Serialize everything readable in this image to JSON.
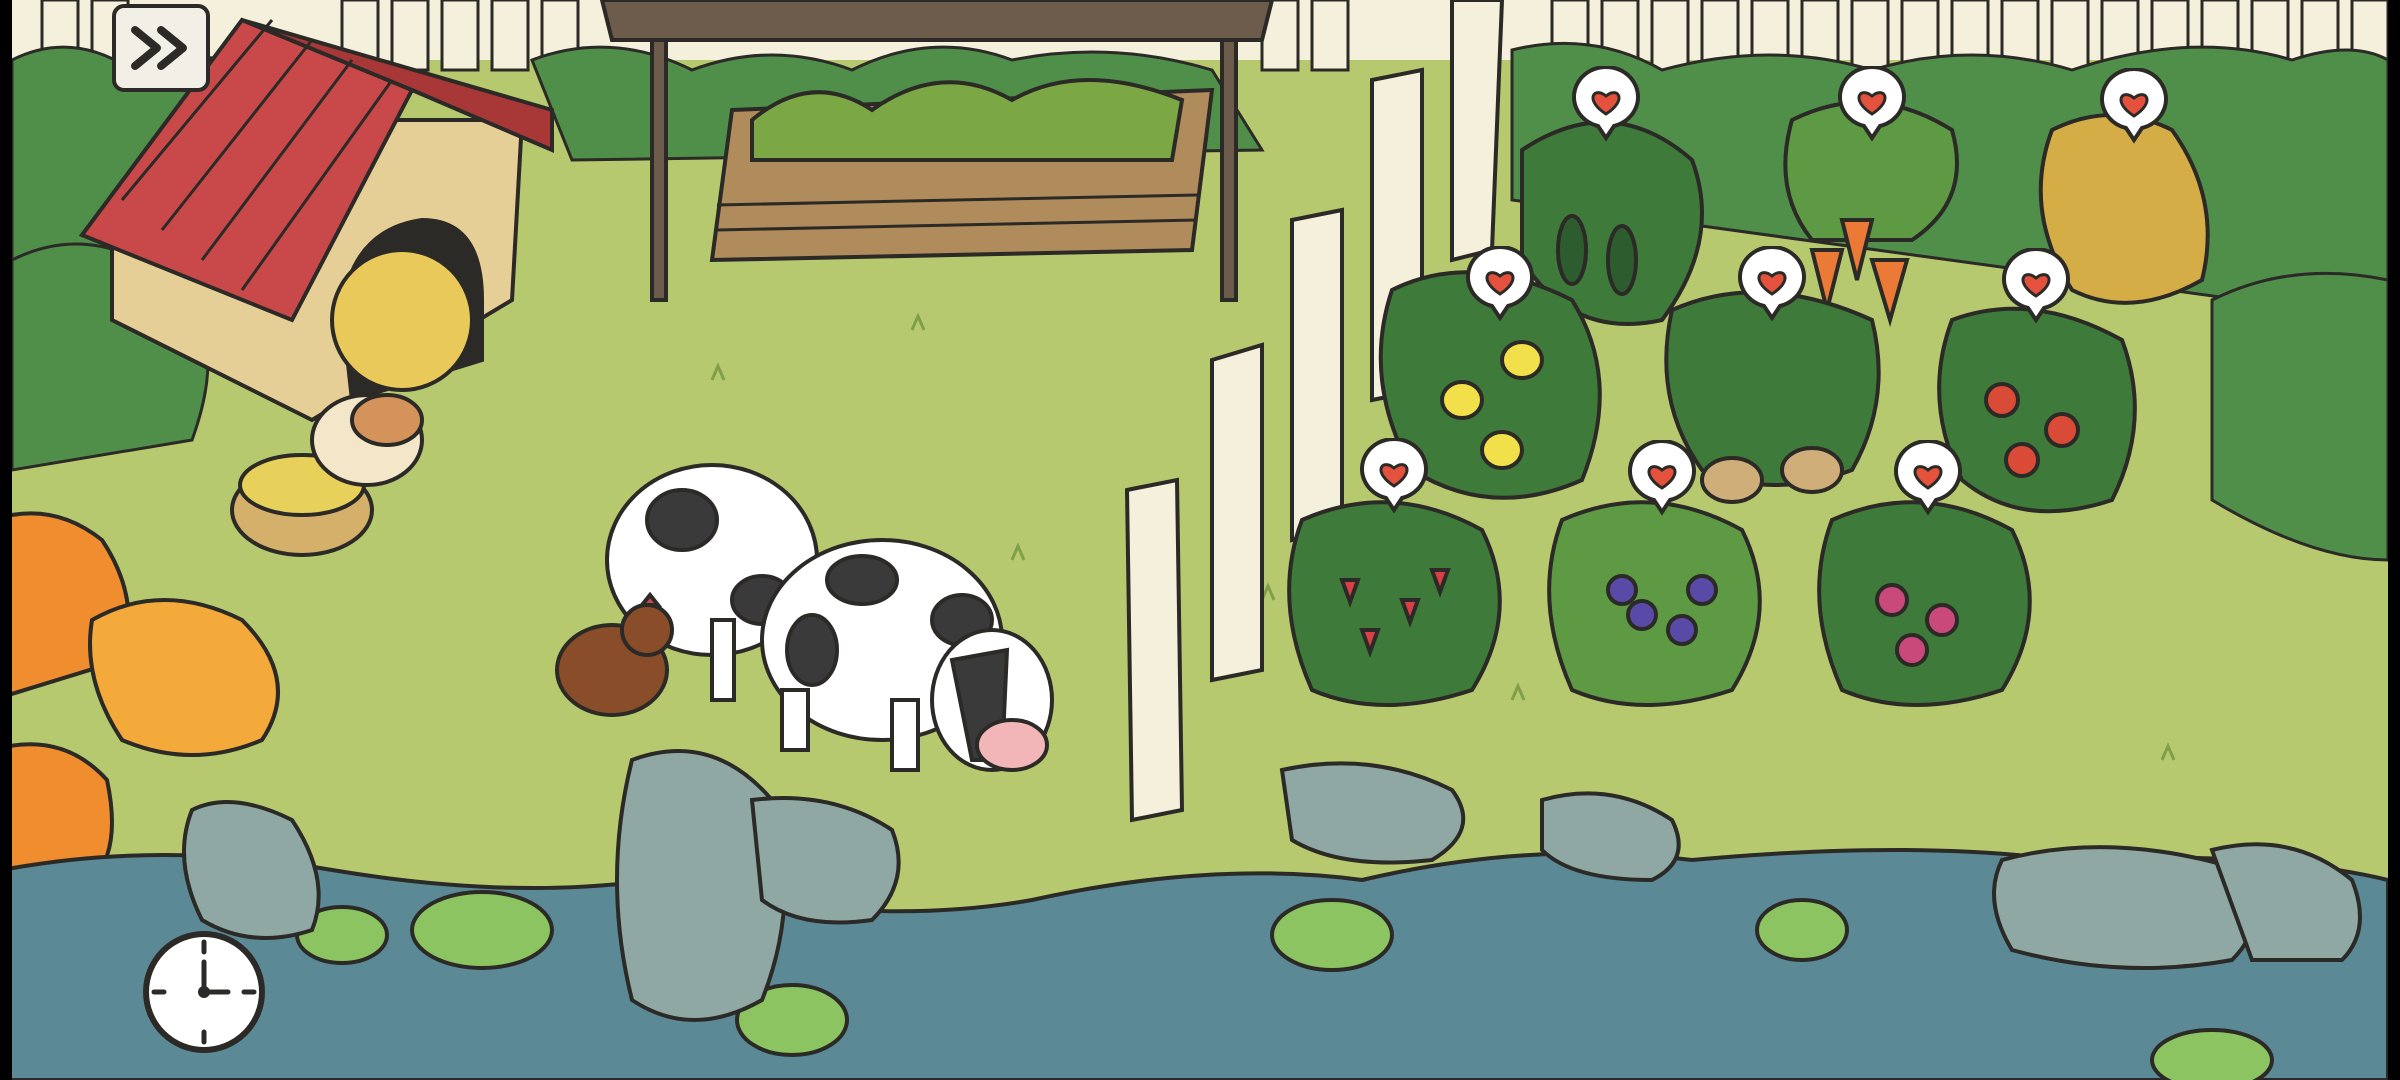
{
  "game": {
    "scene": "backyard-farm",
    "hud": {
      "fast_forward_icon": "fast-forward-icon",
      "clock_icon": "clock-icon"
    },
    "animals": [
      "cow",
      "cow",
      "chicken",
      "hamster"
    ],
    "crops": [
      "cucumber",
      "carrot",
      "wheat",
      "lemon",
      "potato",
      "tomato",
      "strawberry",
      "grape",
      "raspberry"
    ],
    "ready_indicator_icon": "heart-bubble-icon",
    "colors": {
      "grass": "#b7c96f",
      "fence": "#f4f0dc",
      "pond": "#5b8a96",
      "heart": "#e4513d",
      "roof": "#c9494a",
      "hedge": "#4f8f4a"
    }
  }
}
